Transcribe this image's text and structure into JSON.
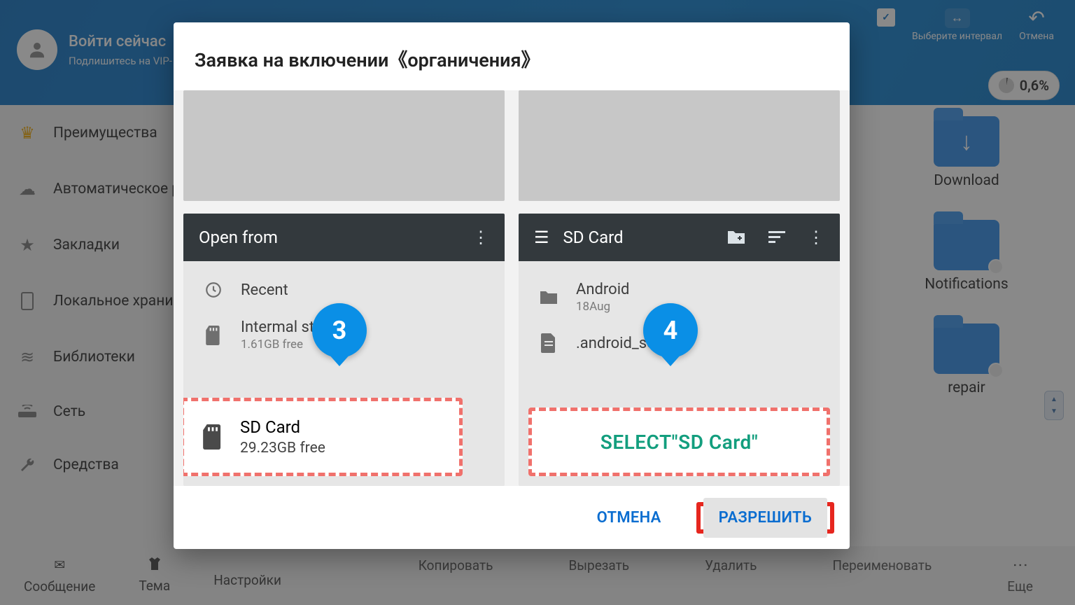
{
  "header": {
    "login_title": "Войти сейчас",
    "login_sub": "Подлишитесь на VIP-",
    "select_interval": "Выберите интервал",
    "cancel": "Отмена",
    "storage_pct": "0,6%"
  },
  "sidebar": {
    "items": [
      {
        "label": "Преимущества",
        "icon": "crown-icon"
      },
      {
        "label": "Автоматическое резервное копир",
        "icon": "cloud-icon"
      },
      {
        "label": "Закладки",
        "icon": "star-icon"
      },
      {
        "label": "Локальное храни",
        "icon": "phone-icon"
      },
      {
        "label": "Библиотеки",
        "icon": "stack-icon"
      },
      {
        "label": "Сеть",
        "icon": "router-icon"
      },
      {
        "label": "Средства",
        "icon": "wrench-icon"
      }
    ]
  },
  "folders": [
    {
      "label": "Download"
    },
    {
      "label": "Notifications"
    },
    {
      "label": "repair"
    }
  ],
  "bottom": {
    "msg": "Сообщение",
    "theme": "Тема",
    "settings": "Настройки",
    "copy": "Копировать",
    "cut": "Вырезать",
    "del": "Удалить",
    "rename": "Переименовать",
    "more": "Еще"
  },
  "dialog": {
    "title": "Заявка на включении《органичения》",
    "cancel": "ОТМЕНА",
    "allow": "РАЗРЕШИТЬ",
    "left": {
      "top": "Open from",
      "recent": "Recent",
      "internal_t": "Intermal stora",
      "internal_s": "1.61GB free",
      "sdcard_t": "SD Card",
      "sdcard_s": "29.23GB free",
      "pin": "3"
    },
    "right": {
      "top": "SD Card",
      "android_t": "Android",
      "android_s": "18Aug",
      "sec_t": ".android_se",
      "select": "SELECT\"SD Card\"",
      "pin": "4"
    }
  }
}
